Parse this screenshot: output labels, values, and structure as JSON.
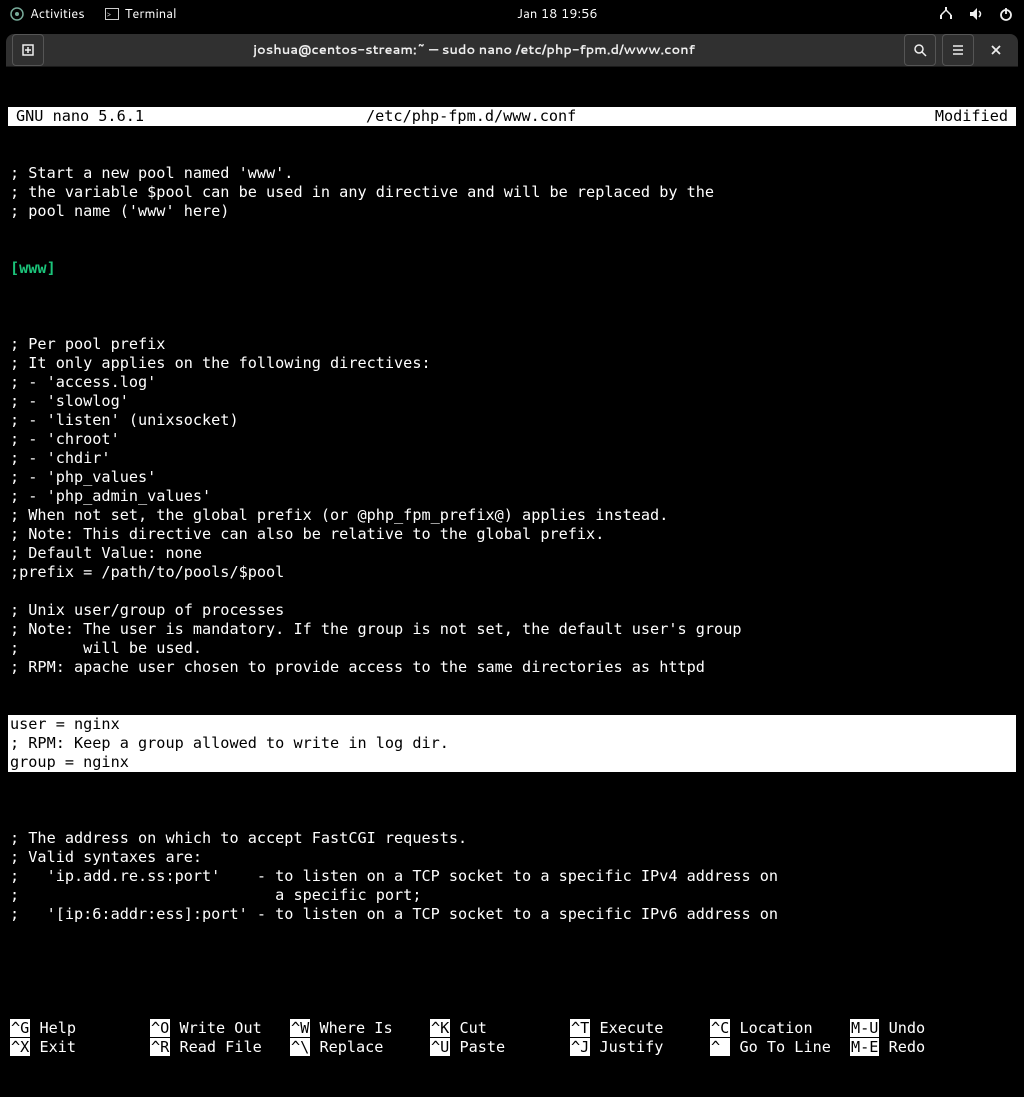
{
  "topbar": {
    "activities": "Activities",
    "terminal": "Terminal",
    "clock": "Jan 18  19:56"
  },
  "titlebar": {
    "title": "joshua@centos-stream:~ — sudo nano /etc/php-fpm.d/www.conf"
  },
  "nano": {
    "version": "GNU nano 5.6.1",
    "filepath": "/etc/php-fpm.d/www.conf",
    "status": "Modified",
    "section": "[www]",
    "lines_pre": [
      "; Start a new pool named 'www'.",
      "; the variable $pool can be used in any directive and will be replaced by the",
      "; pool name ('www' here)"
    ],
    "lines_mid": [
      "",
      "; Per pool prefix",
      "; It only applies on the following directives:",
      "; - 'access.log'",
      "; - 'slowlog'",
      "; - 'listen' (unixsocket)",
      "; - 'chroot'",
      "; - 'chdir'",
      "; - 'php_values'",
      "; - 'php_admin_values'",
      "; When not set, the global prefix (or @php_fpm_prefix@) applies instead.",
      "; Note: This directive can also be relative to the global prefix.",
      "; Default Value: none",
      ";prefix = /path/to/pools/$pool",
      "",
      "; Unix user/group of processes",
      "; Note: The user is mandatory. If the group is not set, the default user's group",
      ";       will be used.",
      "; RPM: apache user chosen to provide access to the same directories as httpd"
    ],
    "hl_lines": [
      "user = nginx",
      "; RPM: Keep a group allowed to write in log dir.",
      "group = nginx"
    ],
    "lines_post": [
      "",
      "; The address on which to accept FastCGI requests.",
      "; Valid syntaxes are:",
      ";   'ip.add.re.ss:port'    - to listen on a TCP socket to a specific IPv4 address on",
      ";                            a specific port;",
      ";   '[ip:6:addr:ess]:port' - to listen on a TCP socket to a specific IPv6 address on"
    ],
    "shortcuts": [
      [
        {
          "k": "^G",
          "l": "Help"
        },
        {
          "k": "^O",
          "l": "Write Out"
        },
        {
          "k": "^W",
          "l": "Where Is"
        },
        {
          "k": "^K",
          "l": "Cut"
        },
        {
          "k": "^T",
          "l": "Execute"
        },
        {
          "k": "^C",
          "l": "Location"
        },
        {
          "k": "M-U",
          "l": "Undo"
        }
      ],
      [
        {
          "k": "^X",
          "l": "Exit"
        },
        {
          "k": "^R",
          "l": "Read File"
        },
        {
          "k": "^\\",
          "l": "Replace"
        },
        {
          "k": "^U",
          "l": "Paste"
        },
        {
          "k": "^J",
          "l": "Justify"
        },
        {
          "k": "^ ",
          "l": "Go To Line"
        },
        {
          "k": "M-E",
          "l": "Redo"
        }
      ]
    ]
  }
}
